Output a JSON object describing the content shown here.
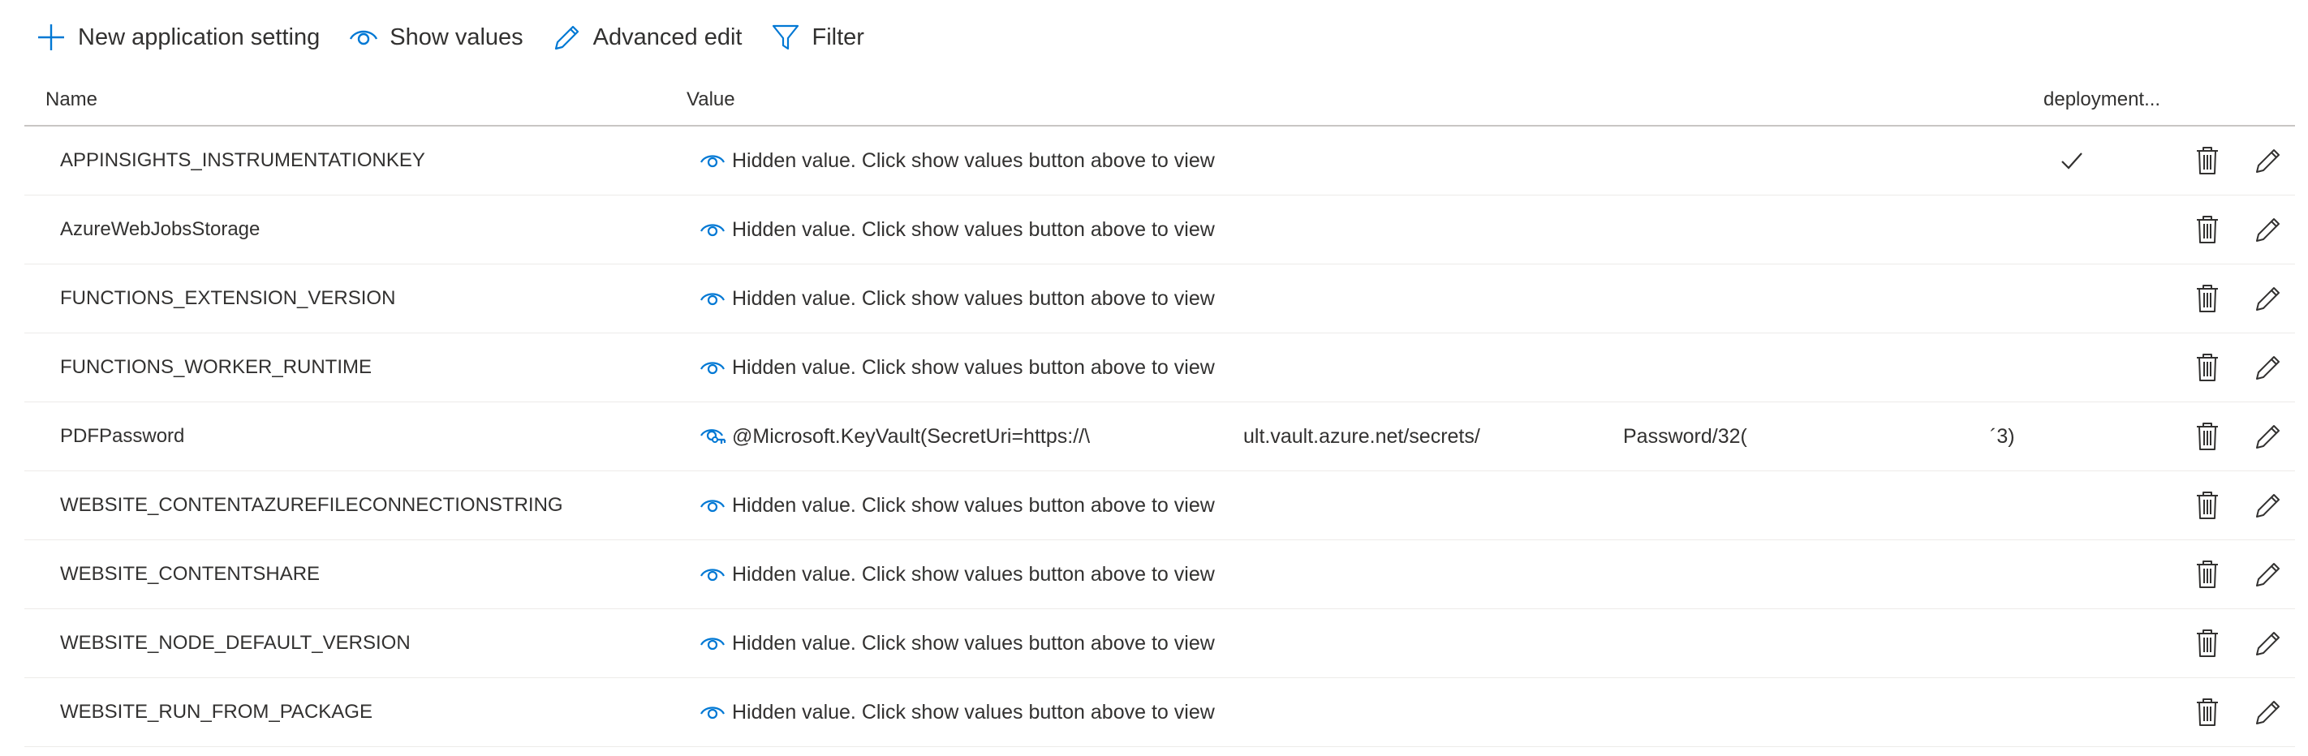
{
  "toolbar": {
    "new_setting_label": "New application setting",
    "show_values_label": "Show values",
    "advanced_edit_label": "Advanced edit",
    "filter_label": "Filter"
  },
  "columns": {
    "name": "Name",
    "value": "Value",
    "deployment": "deployment..."
  },
  "colors": {
    "accent": "#0078d4",
    "text": "#323130",
    "border": "#c8c6c4",
    "row_border": "#edebe9"
  },
  "rows": [
    {
      "name": "APPINSIGHTS_INSTRUMENTATIONKEY",
      "value": "Hidden value. Click show values button above to view",
      "deployment_slot_setting": true,
      "icon": "eye-icon"
    },
    {
      "name": "AzureWebJobsStorage",
      "value": "Hidden value. Click show values button above to view",
      "deployment_slot_setting": false,
      "icon": "eye-icon"
    },
    {
      "name": "FUNCTIONS_EXTENSION_VERSION",
      "value": "Hidden value. Click show values button above to view",
      "deployment_slot_setting": false,
      "icon": "eye-icon"
    },
    {
      "name": "FUNCTIONS_WORKER_RUNTIME",
      "value": "Hidden value. Click show values button above to view",
      "deployment_slot_setting": false,
      "icon": "eye-icon"
    },
    {
      "name": "PDFPassword",
      "value_parts": [
        "@Microsoft.KeyVault(SecretUri=https://\\",
        "ult.vault.azure.net/secrets/",
        "Password/32(",
        "´3)"
      ],
      "deployment_slot_setting": false,
      "icon": "keyvault-reference-icon"
    },
    {
      "name": "WEBSITE_CONTENTAZUREFILECONNECTIONSTRING",
      "value": "Hidden value. Click show values button above to view",
      "deployment_slot_setting": false,
      "icon": "eye-icon"
    },
    {
      "name": "WEBSITE_CONTENTSHARE",
      "value": "Hidden value. Click show values button above to view",
      "deployment_slot_setting": false,
      "icon": "eye-icon"
    },
    {
      "name": "WEBSITE_NODE_DEFAULT_VERSION",
      "value": "Hidden value. Click show values button above to view",
      "deployment_slot_setting": false,
      "icon": "eye-icon"
    },
    {
      "name": "WEBSITE_RUN_FROM_PACKAGE",
      "value": "Hidden value. Click show values button above to view",
      "deployment_slot_setting": false,
      "icon": "eye-icon"
    }
  ]
}
